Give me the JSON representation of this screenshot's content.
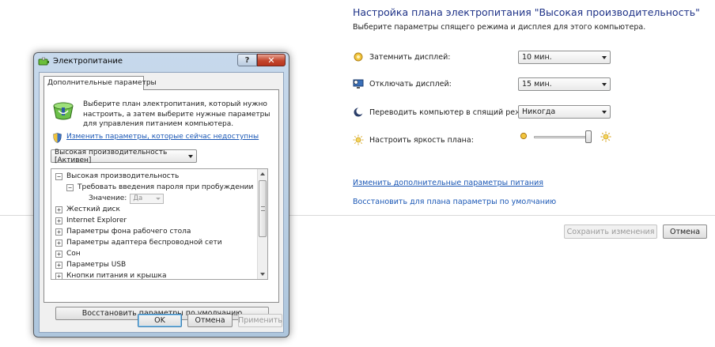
{
  "control_panel": {
    "title": "Настройка плана электропитания \"Высокая производительность\"",
    "subtitle": "Выберите параметры спящего режима и дисплея для этого компьютера.",
    "rows": [
      {
        "icon": "dim-display-icon",
        "label": "Затемнить дисплей:",
        "value": "10 мин."
      },
      {
        "icon": "display-off-icon",
        "label": "Отключать дисплей:",
        "value": "15 мин."
      },
      {
        "icon": "sleep-moon-icon",
        "label": "Переводить компьютер в спящий режим:",
        "value": "Никогда"
      }
    ],
    "brightness": {
      "label": "Настроить яркость плана:",
      "level_percent": 95
    },
    "links": {
      "advanced": "Изменить дополнительные параметры питания",
      "restore_defaults": "Восстановить для плана параметры по умолчанию"
    },
    "buttons": {
      "save": "Сохранить изменения",
      "cancel": "Отмена"
    }
  },
  "dialog": {
    "title": "Электропитание",
    "help_glyph": "?",
    "close_glyph": "✕",
    "tab": "Дополнительные параметры",
    "description": "Выберите план электропитания, который нужно настроить, а затем выберите нужные параметры для управления питанием компьютера.",
    "change_link": "Изменить параметры, которые сейчас недоступны",
    "plan_select": "Высокая производительность [Активен]",
    "tree": [
      {
        "level": 0,
        "expander": "⊟",
        "label": "Высокая производительность"
      },
      {
        "level": 1,
        "expander": "⊟",
        "label": "Требовать введения пароля при пробуждении"
      },
      {
        "level": 2,
        "value_label": "Значение:",
        "value": "Да"
      },
      {
        "level": 0,
        "expander": "⊞",
        "label": "Жесткий диск"
      },
      {
        "level": 0,
        "expander": "⊞",
        "label": "Internet Explorer"
      },
      {
        "level": 0,
        "expander": "⊞",
        "label": "Параметры фона рабочего стола"
      },
      {
        "level": 0,
        "expander": "⊞",
        "label": "Параметры адаптера беспроводной сети"
      },
      {
        "level": 0,
        "expander": "⊞",
        "label": "Сон"
      },
      {
        "level": 0,
        "expander": "⊞",
        "label": "Параметры USB"
      },
      {
        "level": 0,
        "expander": "⊞",
        "label": "Кнопки питания и крышка"
      }
    ],
    "restore_button": "Восстановить параметры по умолчанию",
    "buttons": {
      "ok": "OK",
      "cancel": "Отмена",
      "apply": "Применить"
    }
  },
  "colors": {
    "link": "#1a57b5",
    "title_blue": "#1e3287",
    "close_red": "#c3462d"
  }
}
